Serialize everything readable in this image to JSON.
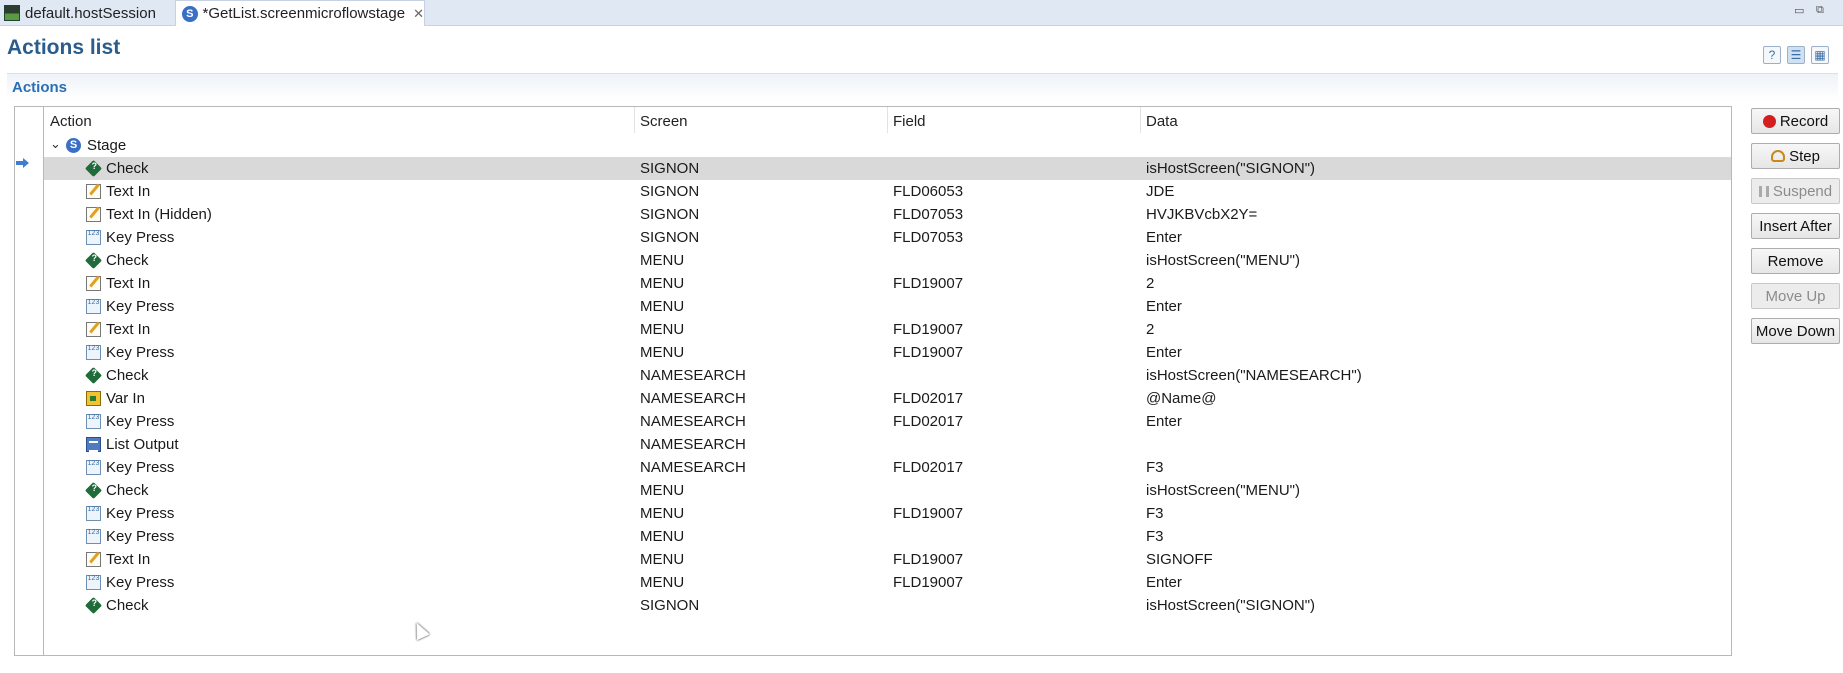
{
  "tabs": [
    {
      "label": "default.hostSession",
      "icon": "host-session-icon",
      "active": false
    },
    {
      "label": "*GetList.screenmicroflowstage",
      "icon": "screen-stage-icon",
      "active": true
    }
  ],
  "window_controls": {
    "minimize": "▭",
    "restore": "▭▭"
  },
  "page_title": "Actions list",
  "header_icons": [
    "help-icon",
    "tree-view-icon",
    "grid-view-icon"
  ],
  "section_title": "Actions",
  "columns": {
    "action": "Action",
    "screen": "Screen",
    "field": "Field",
    "data": "Data"
  },
  "stage": {
    "label": "Stage",
    "icon": "stage-icon",
    "expanded": true
  },
  "rows": [
    {
      "action": "Check",
      "icon": "check",
      "screen": "SIGNON",
      "field": "",
      "data": "isHostScreen(\"SIGNON\")"
    },
    {
      "action": "Text In",
      "icon": "text",
      "screen": "SIGNON",
      "field": "FLD06053",
      "data": "JDE"
    },
    {
      "action": "Text In (Hidden)",
      "icon": "text",
      "screen": "SIGNON",
      "field": "FLD07053",
      "data": "HVJKBVcbX2Y="
    },
    {
      "action": "Key Press",
      "icon": "key",
      "screen": "SIGNON",
      "field": "FLD07053",
      "data": "Enter"
    },
    {
      "action": "Check",
      "icon": "check",
      "screen": "MENU",
      "field": "",
      "data": "isHostScreen(\"MENU\")"
    },
    {
      "action": "Text In",
      "icon": "text",
      "screen": "MENU",
      "field": "FLD19007",
      "data": "2"
    },
    {
      "action": "Key Press",
      "icon": "key",
      "screen": "MENU",
      "field": "",
      "data": "Enter"
    },
    {
      "action": "Text In",
      "icon": "text",
      "screen": "MENU",
      "field": "FLD19007",
      "data": "2"
    },
    {
      "action": "Key Press",
      "icon": "key",
      "screen": "MENU",
      "field": "FLD19007",
      "data": "Enter"
    },
    {
      "action": "Check",
      "icon": "check",
      "screen": "NAMESEARCH",
      "field": "",
      "data": "isHostScreen(\"NAMESEARCH\")"
    },
    {
      "action": "Var In",
      "icon": "var",
      "screen": "NAMESEARCH",
      "field": "FLD02017",
      "data": "@Name@"
    },
    {
      "action": "Key Press",
      "icon": "key",
      "screen": "NAMESEARCH",
      "field": "FLD02017",
      "data": "Enter"
    },
    {
      "action": "List Output",
      "icon": "list",
      "screen": "NAMESEARCH",
      "field": "",
      "data": ""
    },
    {
      "action": "Key Press",
      "icon": "key",
      "screen": "NAMESEARCH",
      "field": "FLD02017",
      "data": "F3"
    },
    {
      "action": "Check",
      "icon": "check",
      "screen": "MENU",
      "field": "",
      "data": "isHostScreen(\"MENU\")"
    },
    {
      "action": "Key Press",
      "icon": "key",
      "screen": "MENU",
      "field": "FLD19007",
      "data": "F3"
    },
    {
      "action": "Key Press",
      "icon": "key",
      "screen": "MENU",
      "field": "",
      "data": "F3"
    },
    {
      "action": "Text In",
      "icon": "text",
      "screen": "MENU",
      "field": "FLD19007",
      "data": "SIGNOFF"
    },
    {
      "action": "Key Press",
      "icon": "key",
      "screen": "MENU",
      "field": "FLD19007",
      "data": "Enter"
    },
    {
      "action": "Check",
      "icon": "check",
      "screen": "SIGNON",
      "field": "",
      "data": "isHostScreen(\"SIGNON\")"
    }
  ],
  "selected_row": 0,
  "buttons": {
    "record": {
      "label": "Record",
      "enabled": true
    },
    "step": {
      "label": "Step",
      "enabled": true
    },
    "suspend": {
      "label": "Suspend",
      "enabled": false
    },
    "insert_after": {
      "label": "Insert After",
      "enabled": true
    },
    "remove": {
      "label": "Remove",
      "enabled": true
    },
    "move_up": {
      "label": "Move Up",
      "enabled": false
    },
    "move_down": {
      "label": "Move Down",
      "enabled": true
    }
  }
}
